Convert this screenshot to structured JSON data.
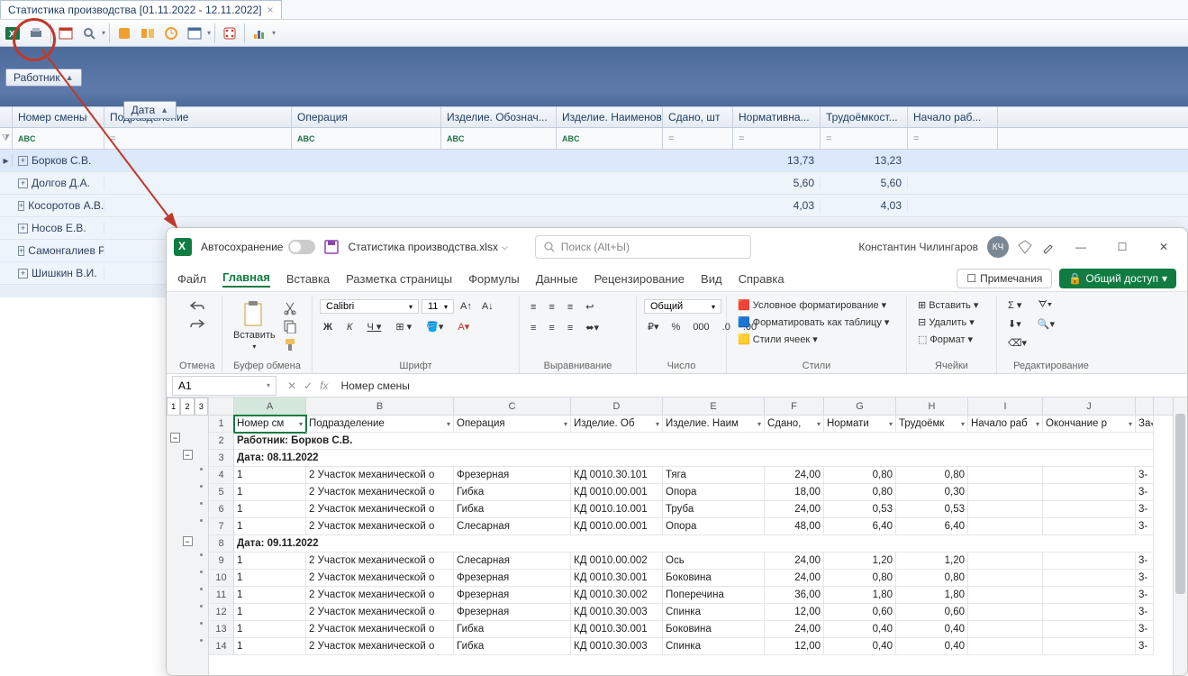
{
  "app": {
    "tab_title": "Статистика производства [01.11.2022 - 12.11.2022]",
    "group_chip_worker": "Работник",
    "group_chip_date": "Дата",
    "columns": {
      "num": "Номер смены",
      "dep": "Подразделение",
      "op": "Операция",
      "izo": "Изделие. Обознач...",
      "izn": "Изделие. Наименова...",
      "sd": "Сдано, шт",
      "nor": "Нормативна...",
      "tru": "Трудоёмкост...",
      "nach": "Начало раб..."
    },
    "filter_abc": "ABC",
    "filter_eq": "=",
    "rows": [
      {
        "name": "Борков С.В.",
        "nor": "13,73",
        "tru": "13,23",
        "sel": true
      },
      {
        "name": "Долгов Д.А.",
        "nor": "5,60",
        "tru": "5,60"
      },
      {
        "name": "Косоротов А.В.",
        "nor": "4,03",
        "tru": "4,03"
      },
      {
        "name": "Носов Е.В.",
        "nor": "",
        "tru": ""
      },
      {
        "name": "Самонгалиев Р.А.",
        "nor": "",
        "tru": ""
      },
      {
        "name": "Шишкин В.И.",
        "nor": "",
        "tru": ""
      }
    ]
  },
  "excel": {
    "autosave_label": "Автосохранение",
    "filename": "Статистика производства.xlsx",
    "search_placeholder": "Поиск (Alt+Ы)",
    "user_name": "Константин Чилингаров",
    "user_initials": "КЧ",
    "tabs": [
      "Файл",
      "Главная",
      "Вставка",
      "Разметка страницы",
      "Формулы",
      "Данные",
      "Рецензирование",
      "Вид",
      "Справка"
    ],
    "comments_btn": "Примечания",
    "share_btn": "Общий доступ",
    "ribbon": {
      "undo": "Отмена",
      "paste": "Вставить",
      "clipboard": "Буфер обмена",
      "font": "Шрифт",
      "font_name": "Calibri",
      "font_size": "11",
      "align": "Выравнивание",
      "number": "Число",
      "number_fmt": "Общий",
      "styles": "Стили",
      "cond_fmt": "Условное форматирование",
      "as_table": "Форматировать как таблицу",
      "cell_styles": "Стили ячеек",
      "cells": "Ячейки",
      "insert": "Вставить",
      "delete": "Удалить",
      "format": "Формат",
      "editing": "Редактирование"
    },
    "name_box": "A1",
    "fx_value": "Номер смены",
    "col_letters": [
      "A",
      "B",
      "C",
      "D",
      "E",
      "F",
      "G",
      "H",
      "I",
      "J"
    ],
    "headers": [
      "Номер см",
      "Подразделение",
      "Операция",
      "Изделие. Об",
      "Изделие. Наим",
      "Сдано,",
      "Нормати",
      "Трудоёмк",
      "Начало раб",
      "Окончание р",
      "За"
    ],
    "rows": [
      {
        "n": 1,
        "type": "header"
      },
      {
        "n": 2,
        "type": "group",
        "text": "Работник: Борков С.В."
      },
      {
        "n": 3,
        "type": "group",
        "text": "Дата: 08.11.2022"
      },
      {
        "n": 4,
        "a": "1",
        "b": "2 Участок механической о",
        "c": "Фрезерная",
        "d": "КД 0010.30.101",
        "e": "Тяга",
        "f": "24,00",
        "g": "0,80",
        "h": "0,80",
        "k": "3-"
      },
      {
        "n": 5,
        "a": "1",
        "b": "2 Участок механической о",
        "c": "Гибка",
        "d": "КД 0010.00.001",
        "e": "Опора",
        "f": "18,00",
        "g": "0,80",
        "h": "0,30",
        "k": "3-"
      },
      {
        "n": 6,
        "a": "1",
        "b": "2 Участок механической о",
        "c": "Гибка",
        "d": "КД 0010.10.001",
        "e": "Труба",
        "f": "24,00",
        "g": "0,53",
        "h": "0,53",
        "k": "3-"
      },
      {
        "n": 7,
        "a": "1",
        "b": "2 Участок механической о",
        "c": "Слесарная",
        "d": "КД 0010.00.001",
        "e": "Опора",
        "f": "48,00",
        "g": "6,40",
        "h": "6,40",
        "k": "3-"
      },
      {
        "n": 8,
        "type": "group",
        "text": "Дата: 09.11.2022"
      },
      {
        "n": 9,
        "a": "1",
        "b": "2 Участок механической о",
        "c": "Слесарная",
        "d": "КД 0010.00.002",
        "e": "Ось",
        "f": "24,00",
        "g": "1,20",
        "h": "1,20",
        "k": "3-"
      },
      {
        "n": 10,
        "a": "1",
        "b": "2 Участок механической о",
        "c": "Фрезерная",
        "d": "КД 0010.30.001",
        "e": "Боковина",
        "f": "24,00",
        "g": "0,80",
        "h": "0,80",
        "k": "3-"
      },
      {
        "n": 11,
        "a": "1",
        "b": "2 Участок механической о",
        "c": "Фрезерная",
        "d": "КД 0010.30.002",
        "e": "Поперечина",
        "f": "36,00",
        "g": "1,80",
        "h": "1,80",
        "k": "3-"
      },
      {
        "n": 12,
        "a": "1",
        "b": "2 Участок механической о",
        "c": "Фрезерная",
        "d": "КД 0010.30.003",
        "e": "Спинка",
        "f": "12,00",
        "g": "0,60",
        "h": "0,60",
        "k": "3-"
      },
      {
        "n": 13,
        "a": "1",
        "b": "2 Участок механической о",
        "c": "Гибка",
        "d": "КД 0010.30.001",
        "e": "Боковина",
        "f": "24,00",
        "g": "0,40",
        "h": "0,40",
        "k": "3-"
      },
      {
        "n": 14,
        "a": "1",
        "b": "2 Участок механической о",
        "c": "Гибка",
        "d": "КД 0010.30.003",
        "e": "Спинка",
        "f": "12,00",
        "g": "0,40",
        "h": "0,40",
        "k": "3-"
      }
    ]
  }
}
